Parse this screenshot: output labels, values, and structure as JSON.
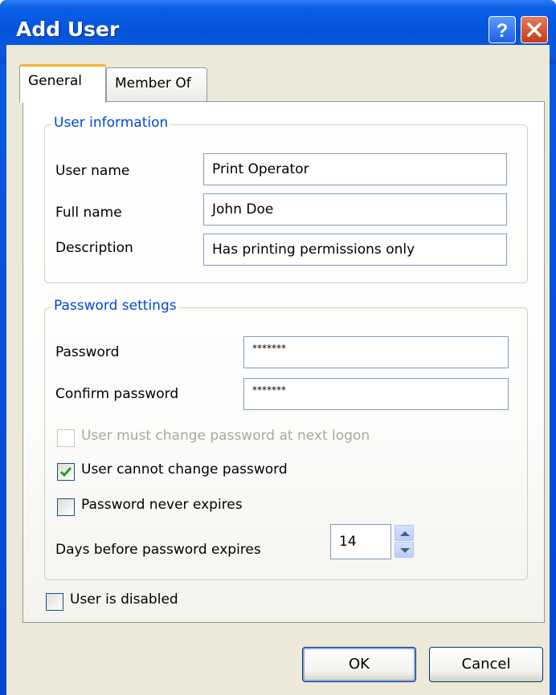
{
  "window": {
    "title": "Add User",
    "help_icon": "question-mark-icon",
    "close_icon": "close-x-icon"
  },
  "tabs": [
    {
      "label": "General",
      "active": true
    },
    {
      "label": "Member Of",
      "active": false
    }
  ],
  "user_information": {
    "legend": "User information",
    "fields": [
      {
        "label": "User name",
        "value": "Print Operator"
      },
      {
        "label": "Full name",
        "value": "John Doe"
      },
      {
        "label": "Description",
        "value": "Has printing permissions only"
      }
    ]
  },
  "password_settings": {
    "legend": "Password settings",
    "password": {
      "label": "Password",
      "value": "*******"
    },
    "confirm_password": {
      "label": "Confirm password",
      "value": "*******"
    },
    "options": [
      {
        "label": "User must change password at next logon",
        "checked": false,
        "disabled": true
      },
      {
        "label": "User cannot change password",
        "checked": true,
        "disabled": false
      },
      {
        "label": "Password never expires",
        "checked": false,
        "disabled": false
      }
    ],
    "days_before_expire": {
      "label": "Days before password expires",
      "value": "14"
    }
  },
  "user_disabled": {
    "label": "User is disabled",
    "checked": false
  },
  "buttons": {
    "ok": "OK",
    "cancel": "Cancel"
  },
  "colors": {
    "title_bar": "#0453da",
    "dialog_bg": "#ece9d8",
    "group_legend": "#0046d5",
    "active_tab_accent": "#f8b030",
    "checkmark": "#21a121"
  }
}
